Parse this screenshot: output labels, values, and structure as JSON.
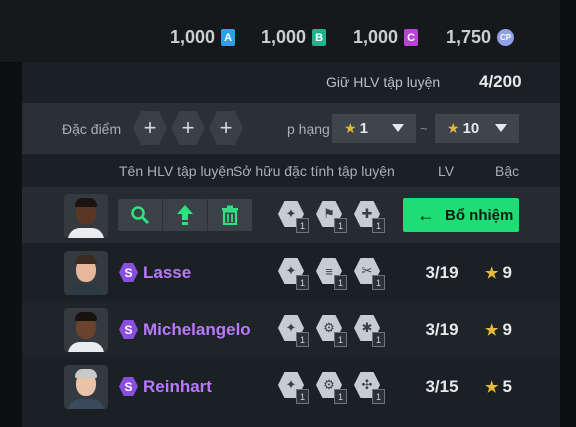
{
  "currencies": [
    {
      "value": "1,000",
      "badge": "A",
      "color": "#2aa3e6"
    },
    {
      "value": "1,000",
      "badge": "B",
      "color": "#1fb38a"
    },
    {
      "value": "1,000",
      "badge": "C",
      "color": "#b845d6"
    },
    {
      "value": "1,750",
      "badge": "CP",
      "color": "#8fa0e6"
    }
  ],
  "keep": {
    "label": "Giữ HLV tập luyện",
    "count": "4/200"
  },
  "filter": {
    "trait_label": "Đặc điểm c",
    "plus": "+",
    "rank_label": "p hạng",
    "rank_from": "1",
    "rank_to": "10",
    "tilde": "~"
  },
  "columns": {
    "name": "Tên HLV tập luyện",
    "traits": "Sở hữu đặc tính tập luyện",
    "lv": "LV",
    "tier": "Bậc"
  },
  "selected_row": {
    "assign_label": "Bổ nhiệm",
    "assign_arrow": "←",
    "trait_levels": [
      "1",
      "1",
      "1"
    ]
  },
  "coaches": [
    {
      "badge": "S",
      "name": "Lasse",
      "lv": "3/19",
      "tier": "9",
      "trait_levels": [
        "1",
        "1",
        "1"
      ]
    },
    {
      "badge": "S",
      "name": "Michelangelo",
      "lv": "3/19",
      "tier": "9",
      "trait_levels": [
        "1",
        "1",
        "1"
      ]
    },
    {
      "badge": "S",
      "name": "Reinhart",
      "lv": "3/15",
      "tier": "5",
      "trait_levels": [
        "1",
        "1",
        "1"
      ]
    }
  ]
}
